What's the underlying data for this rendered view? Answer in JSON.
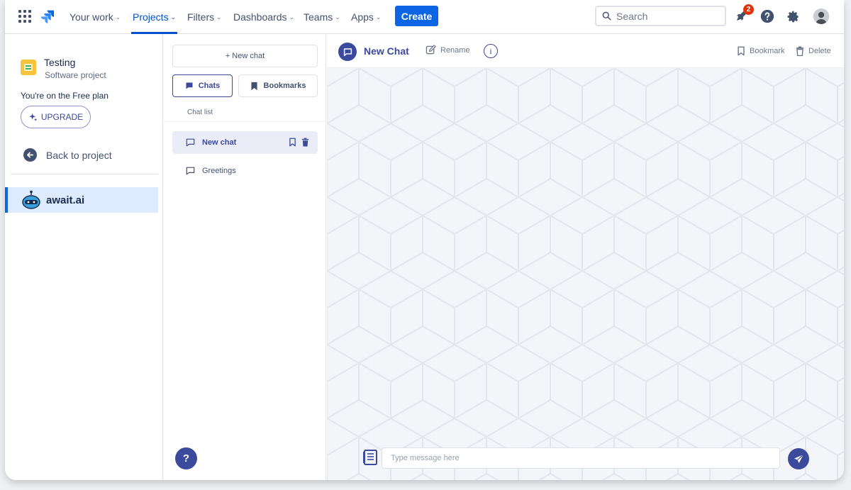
{
  "nav": {
    "items": [
      {
        "label": "Your work"
      },
      {
        "label": "Projects"
      },
      {
        "label": "Filters"
      },
      {
        "label": "Dashboards"
      },
      {
        "label": "Teams"
      },
      {
        "label": "Apps"
      }
    ],
    "active": "Projects",
    "create_label": "Create",
    "search_placeholder": "Search",
    "notification_count": "2"
  },
  "sidebar": {
    "project_name": "Testing",
    "project_type": "Software project",
    "plan_text": "You're on the Free plan",
    "upgrade_label": "UPGRADE",
    "back_label": "Back to project",
    "app_label": "await.ai"
  },
  "chat_panel": {
    "new_chat_label": "+ New chat",
    "tabs": {
      "chats": "Chats",
      "bookmarks": "Bookmarks"
    },
    "list_label": "Chat list",
    "chats": [
      {
        "label": "New chat",
        "selected": true
      },
      {
        "label": "Greetings",
        "selected": false
      }
    ]
  },
  "chat_main": {
    "title": "New Chat",
    "rename_label": "Rename",
    "info_label": "i",
    "bookmark_label": "Bookmark",
    "delete_label": "Delete",
    "input_placeholder": "Type message here"
  },
  "help_label": "?",
  "colors": {
    "brand_blue": "#0c66e4",
    "accent_indigo": "#3b4a9c",
    "badge_red": "#de350b",
    "nav_active": "#0052cc"
  }
}
